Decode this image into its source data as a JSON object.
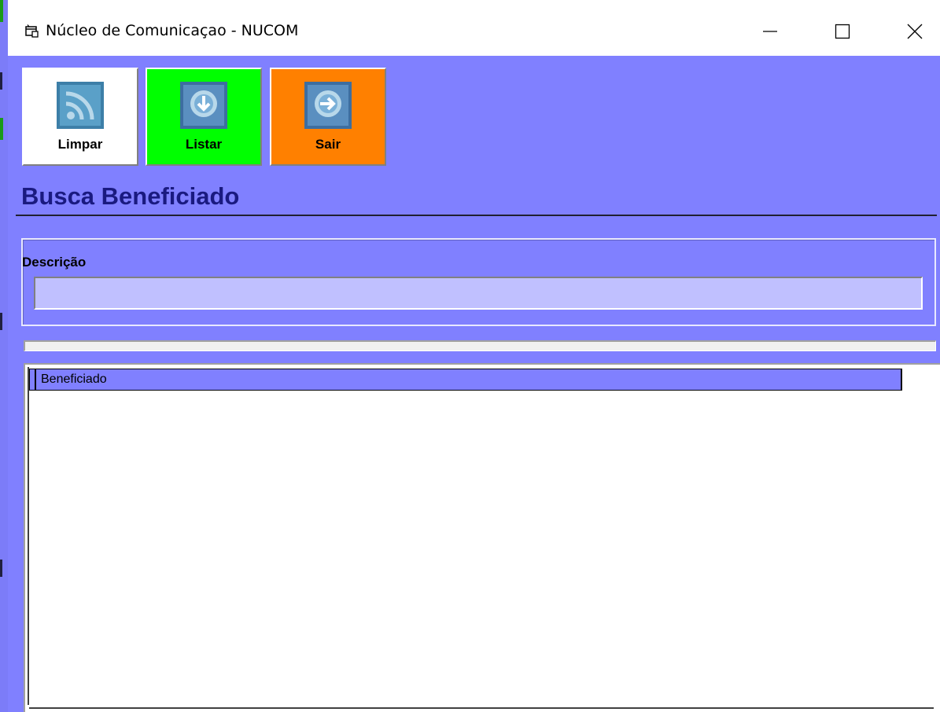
{
  "window": {
    "title": "Núcleo de Comunicaçao - NUCOM",
    "controls": [
      "minimize",
      "maximize",
      "close"
    ]
  },
  "toolbar": {
    "buttons": [
      {
        "label": "Limpar",
        "icon": "rss-icon",
        "color": "#ffffff"
      },
      {
        "label": "Listar",
        "icon": "download-icon",
        "color": "#00ff00"
      },
      {
        "label": "Sair",
        "icon": "arrow-right-icon",
        "color": "#ff8000"
      }
    ]
  },
  "page": {
    "title": "Busca Beneficiado"
  },
  "search": {
    "label": "Descrição",
    "value": ""
  },
  "grid": {
    "columns": [
      "Beneficiado"
    ],
    "rows": []
  },
  "colors": {
    "form_background": "#8080ff",
    "title_text": "#1a1a80",
    "input_background": "#c0c0ff"
  }
}
